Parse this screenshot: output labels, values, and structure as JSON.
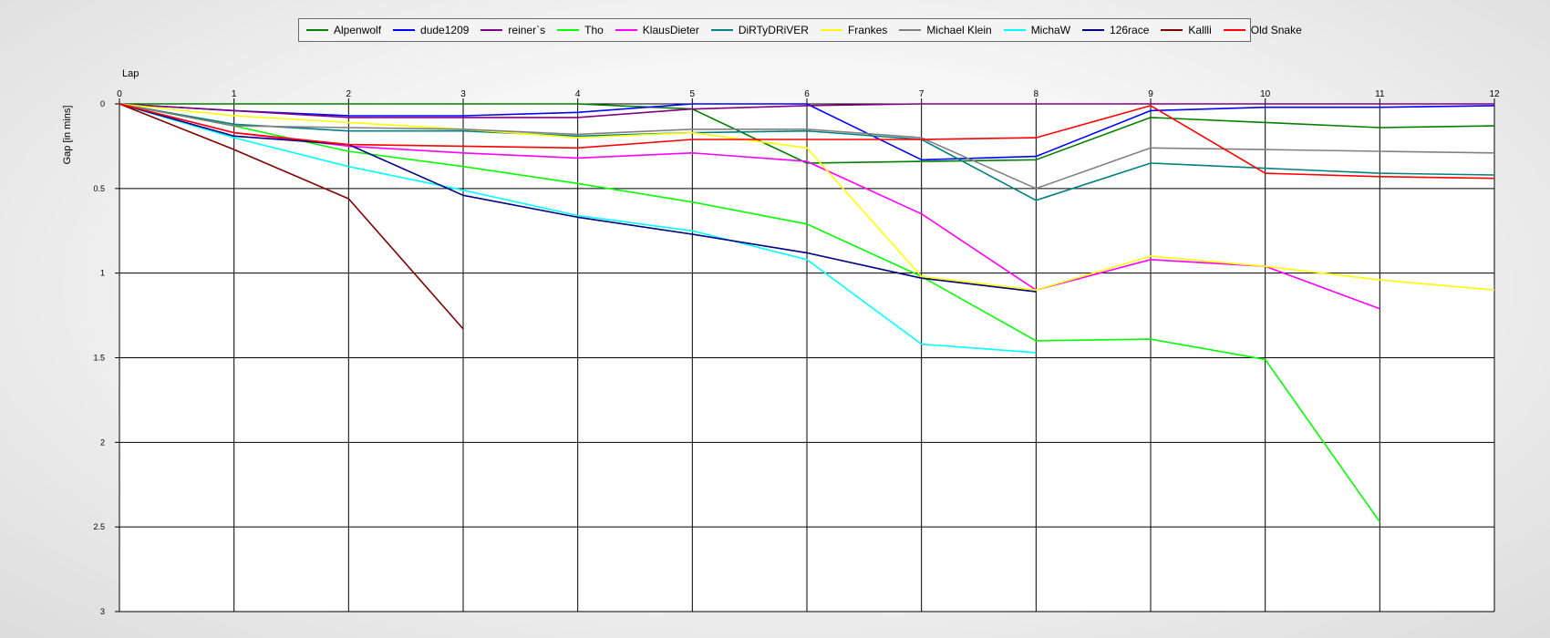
{
  "chart_data": {
    "type": "line",
    "xlabel": "Lap",
    "ylabel": "Gap [in mins]",
    "xlim": [
      0,
      12
    ],
    "ylim": [
      0,
      3
    ],
    "y_inverted": true,
    "x_axis_position": "top",
    "grid": true,
    "legend_position": "top-center",
    "x_ticks": [
      "0",
      "1",
      "2",
      "3",
      "4",
      "5",
      "6",
      "7",
      "8",
      "9",
      "10",
      "11",
      "12"
    ],
    "y_ticks": [
      "0",
      "0.5",
      "1",
      "1.5",
      "2",
      "2.5",
      "3"
    ],
    "series": [
      {
        "name": "Alpenwolf",
        "color": "#008000",
        "x": [
          0,
          1,
          2,
          3,
          4,
          5,
          6,
          7,
          8,
          9,
          10,
          11,
          12
        ],
        "values": [
          0,
          0,
          0,
          0,
          0,
          0.03,
          0.35,
          0.34,
          0.33,
          0.08,
          0.11,
          0.14,
          0.13
        ]
      },
      {
        "name": "dude1209",
        "color": "#0000ff",
        "x": [
          0,
          1,
          2,
          3,
          4,
          5,
          6,
          7,
          8,
          9,
          10,
          11,
          12
        ],
        "values": [
          0,
          0.04,
          0.07,
          0.07,
          0.05,
          0,
          0,
          0.33,
          0.31,
          0.04,
          0.02,
          0.02,
          0.01
        ]
      },
      {
        "name": "reiner`s",
        "color": "#800080",
        "x": [
          0,
          1,
          2,
          3,
          4,
          5,
          6,
          7,
          8,
          9,
          10,
          11,
          12
        ],
        "values": [
          0,
          0.04,
          0.08,
          0.08,
          0.08,
          0.03,
          0.01,
          0,
          0,
          0,
          0,
          0,
          0
        ]
      },
      {
        "name": "Tho",
        "color": "#00ff00",
        "x": [
          0,
          1,
          2,
          3,
          4,
          5,
          6,
          7,
          8,
          9,
          10,
          11
        ],
        "values": [
          0,
          0.13,
          0.28,
          0.37,
          0.47,
          0.58,
          0.71,
          1.02,
          1.4,
          1.39,
          1.51,
          2.47
        ]
      },
      {
        "name": "KlausDieter",
        "color": "#ff00ff",
        "x": [
          0,
          1,
          2,
          3,
          4,
          5,
          6,
          7,
          8,
          9,
          10,
          11
        ],
        "values": [
          0,
          0.17,
          0.25,
          0.29,
          0.32,
          0.29,
          0.34,
          0.65,
          1.1,
          0.92,
          0.96,
          1.21
        ]
      },
      {
        "name": "DiRTyDRiVER",
        "color": "#008080",
        "x": [
          0,
          1,
          2,
          3,
          4,
          5,
          6,
          7,
          8,
          9,
          10,
          11,
          12
        ],
        "values": [
          0,
          0.12,
          0.16,
          0.16,
          0.19,
          0.17,
          0.16,
          0.21,
          0.57,
          0.35,
          0.38,
          0.41,
          0.42
        ]
      },
      {
        "name": "Frankes",
        "color": "#ffff00",
        "x": [
          0,
          1,
          2,
          3,
          4,
          5,
          6,
          7,
          8,
          9,
          10,
          11,
          12
        ],
        "values": [
          0,
          0.07,
          0.11,
          0.15,
          0.2,
          0.17,
          0.26,
          1.02,
          1.1,
          0.9,
          0.96,
          1.04,
          1.1
        ]
      },
      {
        "name": "Michael Klein",
        "color": "#808080",
        "x": [
          0,
          1,
          2,
          3,
          4,
          5,
          6,
          7,
          8,
          9,
          10,
          11,
          12
        ],
        "values": [
          0,
          0.13,
          0.14,
          0.15,
          0.18,
          0.15,
          0.15,
          0.2,
          0.5,
          0.26,
          0.27,
          0.28,
          0.29
        ]
      },
      {
        "name": "MichaW",
        "color": "#00ffff",
        "x": [
          0,
          1,
          2,
          3,
          4,
          5,
          6,
          7,
          8
        ],
        "values": [
          0,
          0.2,
          0.37,
          0.51,
          0.66,
          0.75,
          0.92,
          1.42,
          1.47
        ]
      },
      {
        "name": "126race",
        "color": "#000080",
        "x": [
          0,
          1,
          2,
          3,
          4,
          5,
          6,
          7,
          8
        ],
        "values": [
          0,
          0.19,
          0.24,
          0.54,
          0.67,
          0.77,
          0.88,
          1.03,
          1.11
        ]
      },
      {
        "name": "Kallli",
        "color": "#800000",
        "x": [
          0,
          1,
          2,
          3
        ],
        "values": [
          0,
          0.27,
          0.56,
          1.33
        ]
      },
      {
        "name": "Old Snake",
        "color": "#ff0000",
        "x": [
          0,
          1,
          2,
          3,
          4,
          5,
          6,
          7,
          8,
          9,
          10,
          11,
          12
        ],
        "values": [
          0,
          0.17,
          0.24,
          0.25,
          0.26,
          0.21,
          0.21,
          0.21,
          0.2,
          0.01,
          0.41,
          0.43,
          0.44
        ]
      }
    ]
  }
}
